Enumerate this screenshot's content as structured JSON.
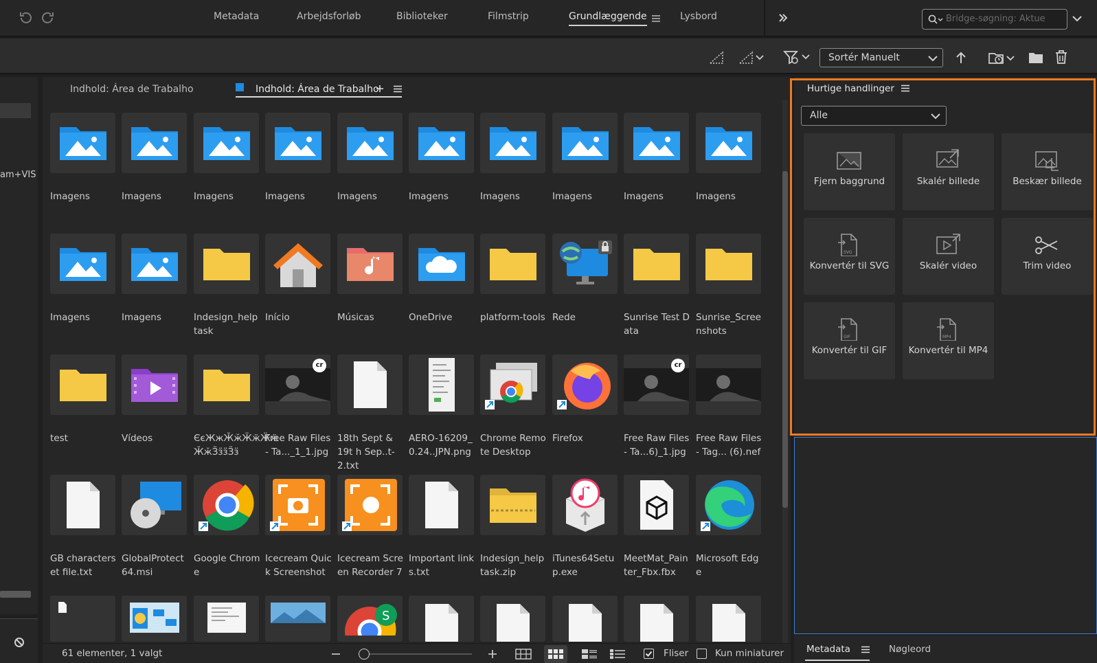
{
  "workspaces": [
    "Metadata",
    "Arbejdsforløb",
    "Biblioteker",
    "Filmstrip",
    "Grundlæggende",
    "Lysbord"
  ],
  "active_workspace": "Grundlæggende",
  "search": {
    "placeholder": "Bridge-søgning: Aktue"
  },
  "toolbar": {
    "sort_label": "Sortér Manuelt"
  },
  "left_panel": {
    "fragment": "am+VIS"
  },
  "content_tabs": [
    {
      "label": "Indhold: Área de Trabalho"
    },
    {
      "label": "Indhold: Área de Trabalho"
    }
  ],
  "items": [
    {
      "label": "Imagens",
      "kind": "images-folder"
    },
    {
      "label": "Imagens",
      "kind": "images-folder"
    },
    {
      "label": "Imagens",
      "kind": "images-folder"
    },
    {
      "label": "Imagens",
      "kind": "images-folder"
    },
    {
      "label": "Imagens",
      "kind": "images-folder"
    },
    {
      "label": "Imagens",
      "kind": "images-folder"
    },
    {
      "label": "Imagens",
      "kind": "images-folder"
    },
    {
      "label": "Imagens",
      "kind": "images-folder"
    },
    {
      "label": "Imagens",
      "kind": "images-folder"
    },
    {
      "label": "Imagens",
      "kind": "images-folder"
    },
    {
      "label": "Imagens",
      "kind": "images-folder"
    },
    {
      "label": "Imagens",
      "kind": "images-folder"
    },
    {
      "label": "Indesign_help task",
      "kind": "folder"
    },
    {
      "label": "Início",
      "kind": "home"
    },
    {
      "label": "Músicas",
      "kind": "music"
    },
    {
      "label": "OneDrive",
      "kind": "onedrive"
    },
    {
      "label": "platform-tools",
      "kind": "folder"
    },
    {
      "label": "Rede",
      "kind": "network"
    },
    {
      "label": "Sunrise Test D ata",
      "kind": "folder"
    },
    {
      "label": "Sunrise_Scree nshots",
      "kind": "folder"
    },
    {
      "label": "test",
      "kind": "folder"
    },
    {
      "label": "Vídeos",
      "kind": "videos"
    },
    {
      "label": "ЄєЖжӁӂӜӝӜӝ ӁӂӞӟӟӞӟ",
      "kind": "folder"
    },
    {
      "label": "Free Raw Files - Ta..._1_1.jpg",
      "kind": "photo-cr"
    },
    {
      "label": "18th Sept & 19t h Sep..t- 2.txt",
      "kind": "doc"
    },
    {
      "label": "AERO-16209_ 0.24..JPN.png",
      "kind": "screenshot"
    },
    {
      "label": "Chrome Remo te Desktop",
      "kind": "remote-desktop"
    },
    {
      "label": "Firefox",
      "kind": "firefox"
    },
    {
      "label": "Free Raw Files - Ta...6)_1.jpg",
      "kind": "photo-cr"
    },
    {
      "label": "Free Raw Files - Tag... (6).nef",
      "kind": "photo"
    },
    {
      "label": "GB characters et file.txt",
      "kind": "doc"
    },
    {
      "label": "GlobalProtect 64.msi",
      "kind": "installer"
    },
    {
      "label": "Google Chrom e",
      "kind": "chrome"
    },
    {
      "label": "Icecream Quic k Screenshot",
      "kind": "icecream-1"
    },
    {
      "label": "Icecream Scre en Recorder 7",
      "kind": "icecream-2"
    },
    {
      "label": "Important link s.txt",
      "kind": "doc"
    },
    {
      "label": "Indesign_help task.zip",
      "kind": "zip"
    },
    {
      "label": "iTunes64Setu p.exe",
      "kind": "itunes"
    },
    {
      "label": "MeetMat_Pain ter_Fbx.fbx",
      "kind": "fbx"
    },
    {
      "label": "Microsoft Edg e",
      "kind": "edge"
    },
    {
      "label": "",
      "kind": "doc-small"
    },
    {
      "label": "",
      "kind": "chart-doc"
    },
    {
      "label": "",
      "kind": "page"
    },
    {
      "label": "",
      "kind": "landscape"
    },
    {
      "label": "",
      "kind": "chrome-s"
    },
    {
      "label": "",
      "kind": "doc"
    },
    {
      "label": "",
      "kind": "doc"
    },
    {
      "label": "",
      "kind": "doc"
    },
    {
      "label": "",
      "kind": "doc"
    },
    {
      "label": "",
      "kind": "doc"
    }
  ],
  "quick_actions": {
    "title": "Hurtige handlinger",
    "filter": "Alle",
    "actions": [
      {
        "label": "Fjern baggrund",
        "icon": "remove-bg"
      },
      {
        "label": "Skalér billede",
        "icon": "scale-image"
      },
      {
        "label": "Beskær billede",
        "icon": "crop-image"
      },
      {
        "label": "Konvertér til SVG",
        "icon": "svg-file"
      },
      {
        "label": "Skalér video",
        "icon": "scale-video"
      },
      {
        "label": "Trim video",
        "icon": "scissors"
      },
      {
        "label": "Konvertér til GIF",
        "icon": "gif-file"
      },
      {
        "label": "Konvertér til MP4",
        "icon": "mp4-file"
      }
    ]
  },
  "status": {
    "text": "61 elementer, 1 valgt",
    "tiles_label": "Fliser",
    "thumbs_only_label": "Kun miniaturer",
    "tiles_checked": true,
    "thumbs_only_checked": false
  },
  "bottom_tabs": [
    "Metadata",
    "Nøgleord"
  ],
  "colors": {
    "highlight": "#f07a22",
    "folder": "#f5c945",
    "image_folder": "#1e8be0",
    "tab_marker": "#1e8be0"
  }
}
